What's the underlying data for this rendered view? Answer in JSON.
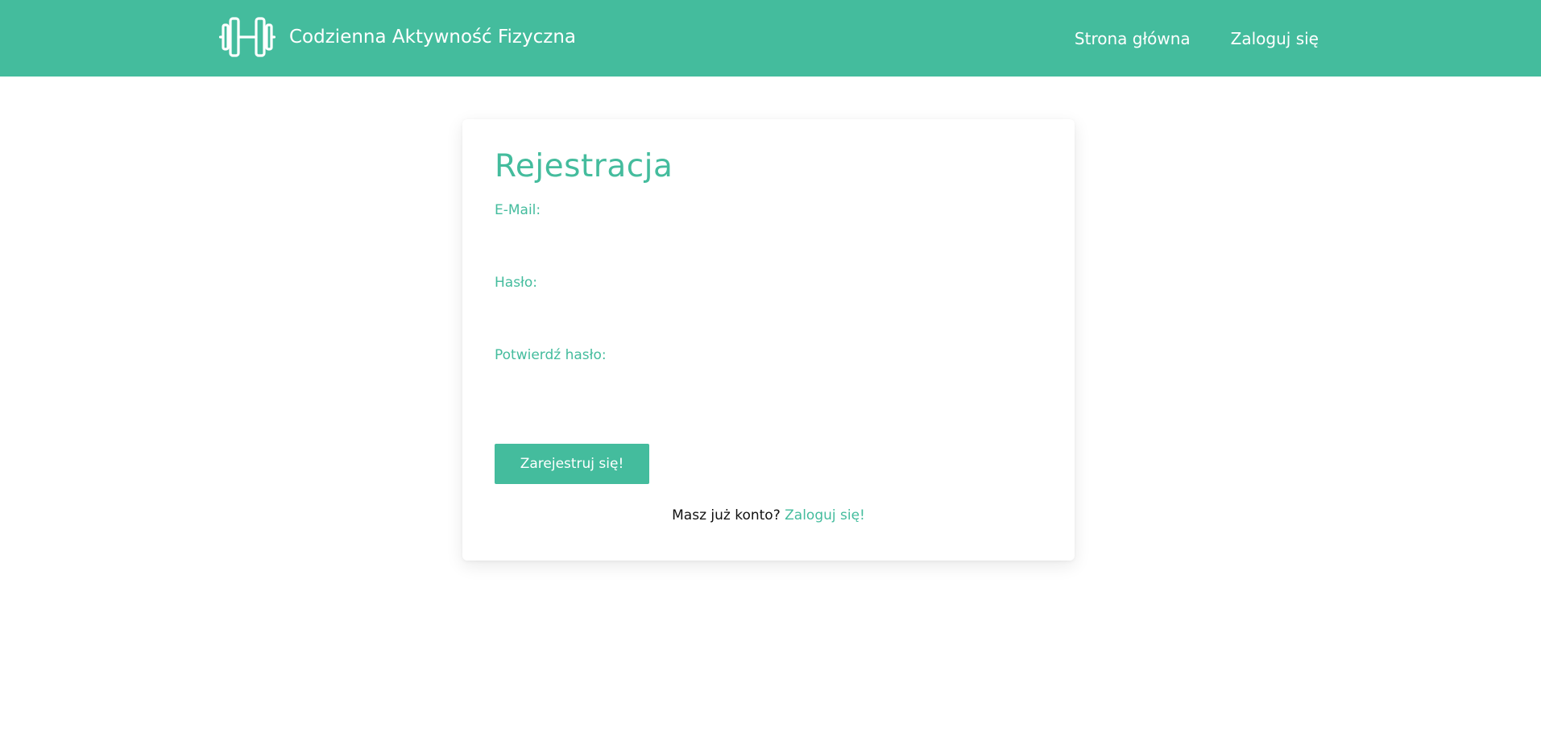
{
  "brand": {
    "title": "Codzienna Aktywność Fizyczna",
    "logo_icon": "dumbbell-icon",
    "color": "#44bc9d"
  },
  "nav": {
    "items": [
      {
        "label": "Strona główna"
      },
      {
        "label": "Zaloguj się"
      }
    ]
  },
  "form": {
    "title": "Rejestracja",
    "fields": {
      "email": {
        "label": "E-Mail:",
        "value": "",
        "placeholder": ""
      },
      "password": {
        "label": "Hasło:",
        "value": "",
        "placeholder": ""
      },
      "confirm_password": {
        "label": "Potwierdź hasło:",
        "value": "",
        "placeholder": ""
      }
    },
    "submit_label": "Zarejestruj się!",
    "footer_text": "Masz już konto?",
    "footer_link": "Zaloguj się!"
  }
}
